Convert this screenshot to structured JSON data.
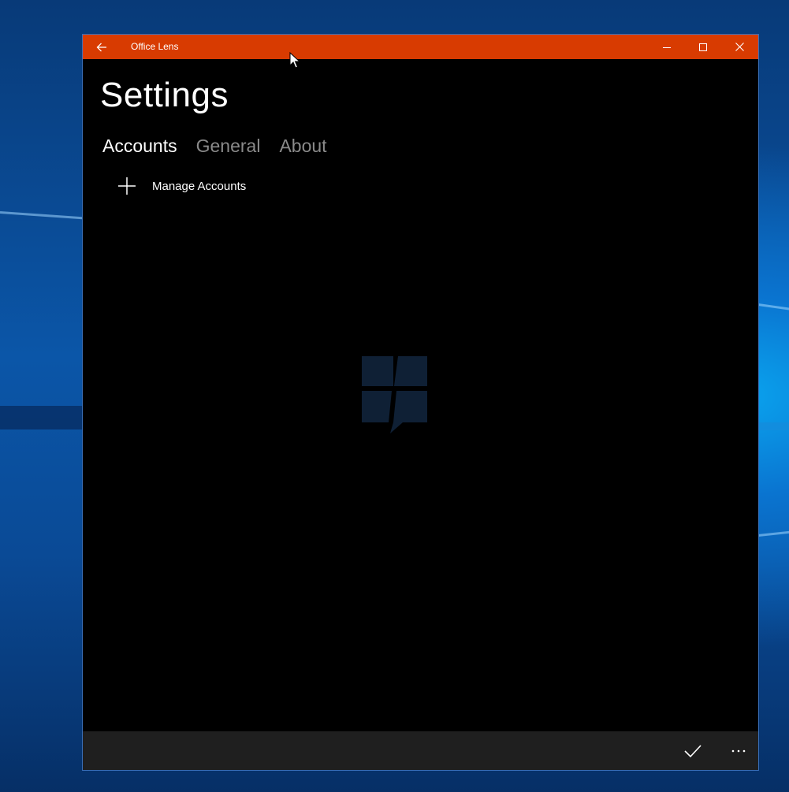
{
  "window": {
    "title": "Office Lens",
    "accent_color": "#d83b01",
    "background_color": "#000000",
    "appbar_color": "#1f1f1f"
  },
  "titlebar": {
    "back_icon": "arrow-left-icon",
    "minimize_icon": "minimize-icon",
    "maximize_icon": "maximize-icon",
    "close_icon": "close-icon"
  },
  "page": {
    "title": "Settings"
  },
  "tabs": [
    {
      "label": "Accounts",
      "active": true
    },
    {
      "label": "General",
      "active": false
    },
    {
      "label": "About",
      "active": false
    }
  ],
  "accounts": {
    "manage_label": "Manage Accounts",
    "manage_icon": "plus-icon"
  },
  "splash": {
    "icon": "feedback-logo-icon",
    "color": "#0f2035"
  },
  "appbar": {
    "accept_icon": "checkmark-icon",
    "more_icon": "more-icon"
  }
}
